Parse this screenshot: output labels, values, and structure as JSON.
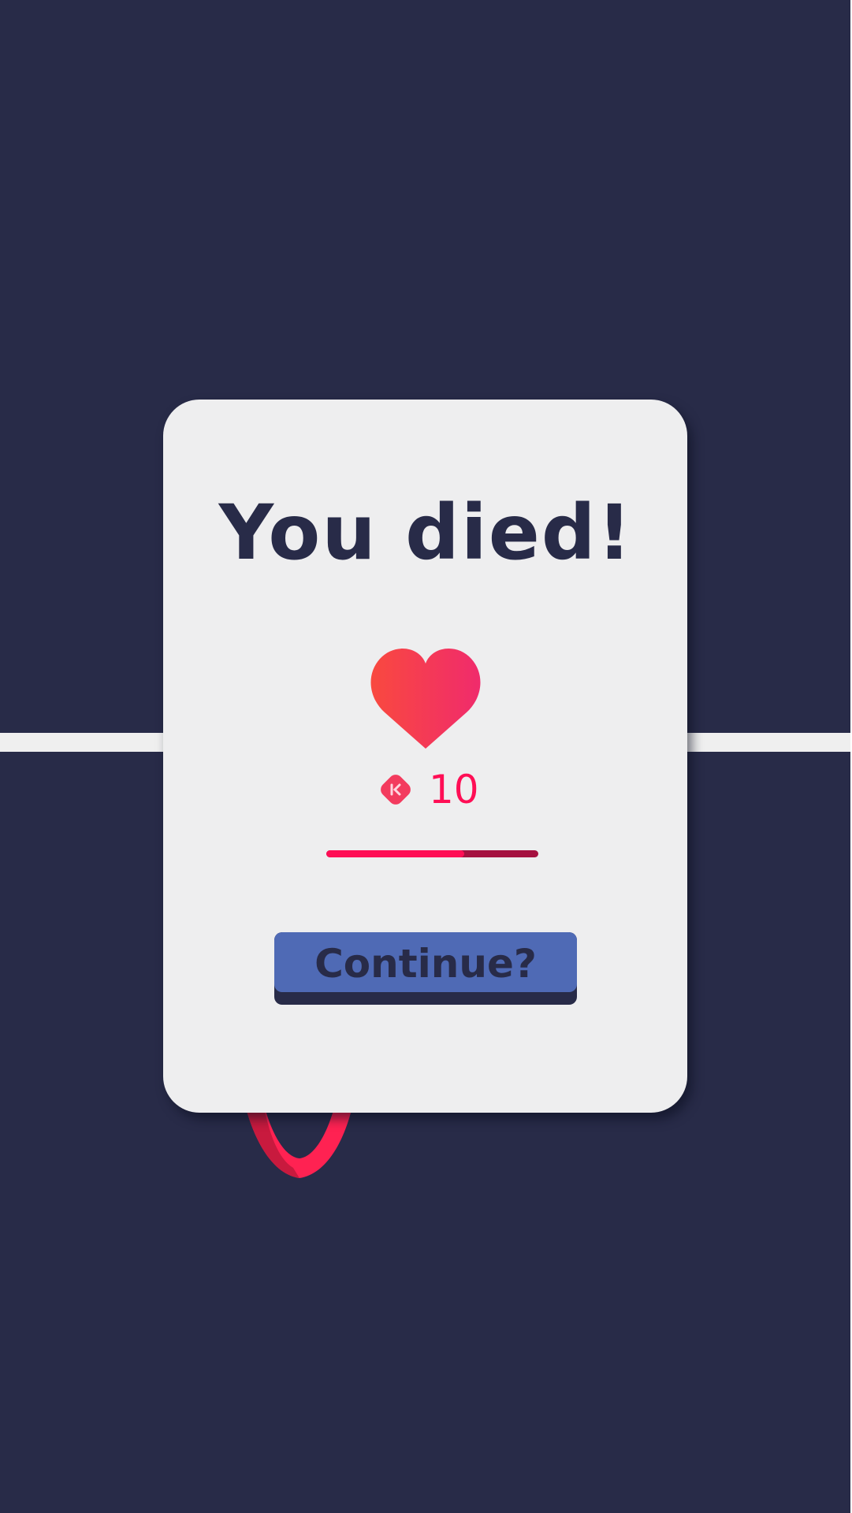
{
  "dialog": {
    "title": "You died!",
    "lives_count": "10",
    "progress_fraction": 0.65,
    "continue_label": "Continue?"
  },
  "icons": {
    "heart": "heart-icon",
    "gem": "gem-icon"
  },
  "colors": {
    "background": "#282b48",
    "card": "#eeeeef",
    "accent": "#ff0e55",
    "button": "#4f6ab5",
    "heart_start": "#f9493f",
    "heart_end": "#f02b6c"
  }
}
